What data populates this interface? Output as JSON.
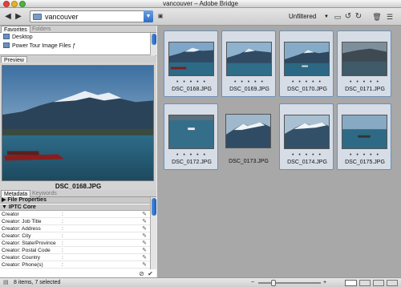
{
  "window": {
    "title": "vancouver – Adobe Bridge"
  },
  "toolbar": {
    "back_icon": "back-arrow-icon",
    "forward_icon": "forward-arrow-icon",
    "folder_value": "vancouver",
    "filter_label": "Unfiltered",
    "icons": [
      "new-folder-icon",
      "rotate-left-icon",
      "rotate-right-icon",
      "trash-icon",
      "menu-icon"
    ]
  },
  "panels": {
    "favorites_tab": "Favorites",
    "folders_tab": "Folders",
    "favorites": [
      "Desktop",
      "Power Tour Image Files ƒ"
    ],
    "preview_tab": "Preview",
    "preview_name": "DSC_0168.JPG",
    "metadata_tab": "Metadata",
    "keywords_tab": "Keywords",
    "sections": [
      "File Properties",
      "IPTC Core"
    ],
    "fields": [
      "Creator",
      "Creator: Job Title",
      "Creator: Address",
      "Creator: City",
      "Creator: State/Province",
      "Creator: Postal Code",
      "Creator: Country",
      "Creator: Phone(s)"
    ]
  },
  "thumbnails": [
    {
      "name": "DSC_0168.JPG",
      "selected": true
    },
    {
      "name": "DSC_0169.JPG",
      "selected": true
    },
    {
      "name": "DSC_0170.JPG",
      "selected": true
    },
    {
      "name": "DSC_0171.JPG",
      "selected": true
    },
    {
      "name": "DSC_0172.JPG",
      "selected": true
    },
    {
      "name": "DSC_0173.JPG",
      "selected": false
    },
    {
      "name": "DSC_0174.JPG",
      "selected": true
    },
    {
      "name": "DSC_0175.JPG",
      "selected": true
    }
  ],
  "status": {
    "text": "8 items, 7 selected"
  },
  "colors": {
    "accent": "#2f6cc6",
    "selected_bg": "#d6dde6",
    "content_bg": "#a8a8a8"
  }
}
